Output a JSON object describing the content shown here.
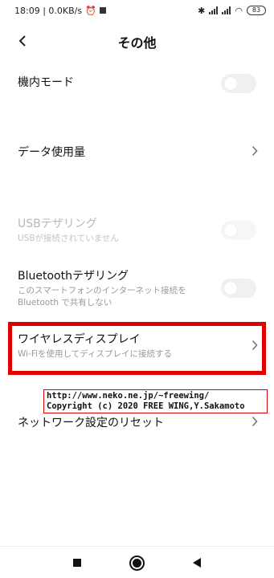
{
  "status_bar": {
    "time_speed": "18:09 | 0.0KB/s",
    "battery": "83"
  },
  "header": {
    "title": "その他"
  },
  "rows": {
    "airplane_mode": {
      "title": "機内モード",
      "enabled": false
    },
    "data_usage": {
      "title": "データ使用量"
    },
    "usb_tethering": {
      "title": "USBテザリング",
      "subtitle": "USBが接続されていません",
      "enabled": false,
      "disabled": true
    },
    "bluetooth_tethering": {
      "title": "Bluetoothテザリング",
      "subtitle": "このスマートフォンのインターネット接続をBluetooth で共有しない",
      "enabled": false
    },
    "wireless_display": {
      "title": "ワイヤレスディスプレイ",
      "subtitle": "Wi-Fiを使用してディスプレイに接続する"
    },
    "network_reset": {
      "title": "ネットワーク設定のリセット"
    }
  },
  "watermark": {
    "line1": "http://www.neko.ne.jp/~freewing/",
    "line2": "Copyright (c) 2020 FREE WING,Y.Sakamoto"
  },
  "colors": {
    "highlight": "#e00000",
    "toggle_off": "#f0f0f0",
    "subtitle": "#999999"
  }
}
